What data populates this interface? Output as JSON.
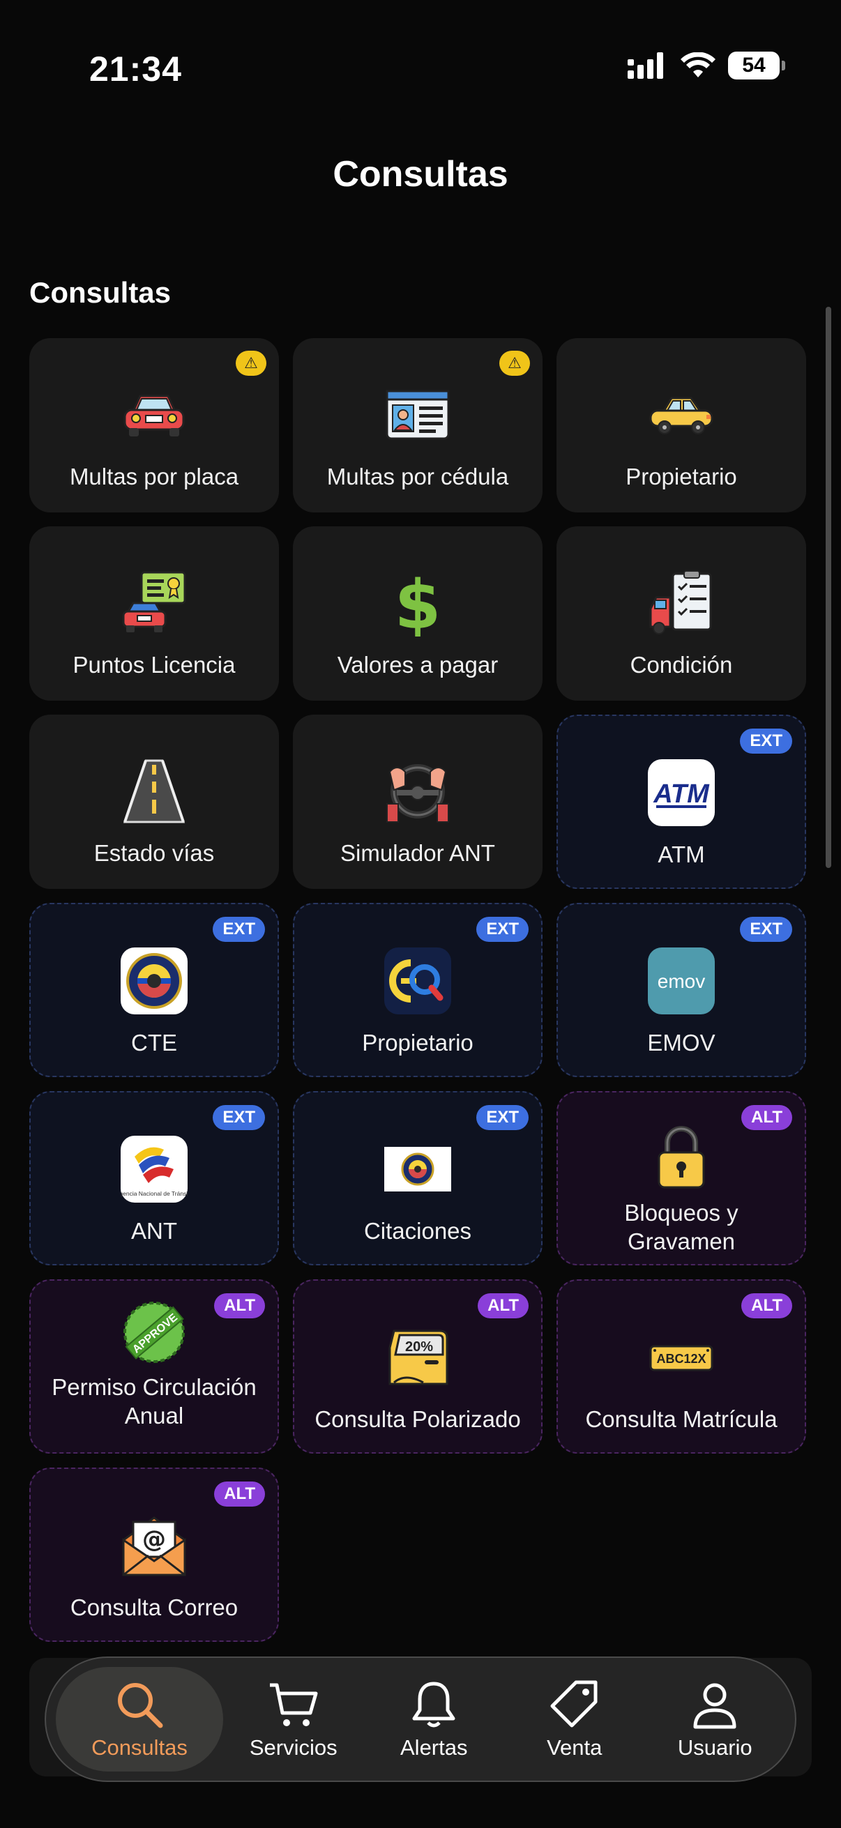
{
  "status_bar": {
    "time": "21:34",
    "battery": "54"
  },
  "header": {
    "title": "Consultas"
  },
  "section": {
    "title": "Consultas"
  },
  "cards": [
    {
      "label": "Multas por placa",
      "icon": "red-car-icon",
      "badge": "warning"
    },
    {
      "label": "Multas por cédula",
      "icon": "id-card-icon",
      "badge": "warning"
    },
    {
      "label": "Propietario",
      "icon": "yellow-taxi-icon",
      "badge": ""
    },
    {
      "label": "Puntos Licencia",
      "icon": "license-points-icon",
      "badge": ""
    },
    {
      "label": "Valores a pagar",
      "icon": "dollar-icon",
      "badge": ""
    },
    {
      "label": "Condición",
      "icon": "vehicle-checklist-icon",
      "badge": ""
    },
    {
      "label": "Estado vías",
      "icon": "road-icon",
      "badge": ""
    },
    {
      "label": "Simulador ANT",
      "icon": "steering-wheel-icon",
      "badge": ""
    },
    {
      "label": "ATM",
      "icon": "atm-logo-icon",
      "badge": "EXT"
    },
    {
      "label": "CTE",
      "icon": "cte-logo-icon",
      "badge": "EXT"
    },
    {
      "label": "Propietario",
      "icon": "eq-logo-icon",
      "badge": "EXT"
    },
    {
      "label": "EMOV",
      "icon": "emov-logo-icon",
      "badge": "EXT"
    },
    {
      "label": "ANT",
      "icon": "ant-logo-icon",
      "badge": "EXT"
    },
    {
      "label": "Citaciones",
      "icon": "citaciones-logo-icon",
      "badge": "EXT"
    },
    {
      "label": "Bloqueos y Gravamen",
      "icon": "padlock-icon",
      "badge": "ALT"
    },
    {
      "label": "Permiso Circulación Anual",
      "icon": "approve-stamp-icon",
      "badge": "ALT"
    },
    {
      "label": "Consulta Polarizado",
      "icon": "tinted-door-icon",
      "badge": "ALT"
    },
    {
      "label": "Consulta Matrícula",
      "icon": "license-plate-icon",
      "badge": "ALT"
    },
    {
      "label": "Consulta Correo",
      "icon": "email-envelope-icon",
      "badge": "ALT"
    }
  ],
  "logos": {
    "atm": "ATM",
    "emov": "emov",
    "plate": "ABC12X",
    "tint": "20%",
    "ant_caption": "Agencia Nacional de Tránsito",
    "approve": "APPROVE"
  },
  "nav": {
    "items": [
      {
        "label": "Consultas",
        "icon": "search-icon",
        "active": true
      },
      {
        "label": "Servicios",
        "icon": "cart-icon",
        "active": false
      },
      {
        "label": "Alertas",
        "icon": "bell-icon",
        "active": false
      },
      {
        "label": "Venta",
        "icon": "tag-icon",
        "active": false
      },
      {
        "label": "Usuario",
        "icon": "user-icon",
        "active": false
      }
    ]
  },
  "colors": {
    "accent": "#f29b5a",
    "ext_badge": "#3d6fe0",
    "alt_badge": "#8a3fd9",
    "warning": "#f0c419",
    "background": "#080808"
  }
}
